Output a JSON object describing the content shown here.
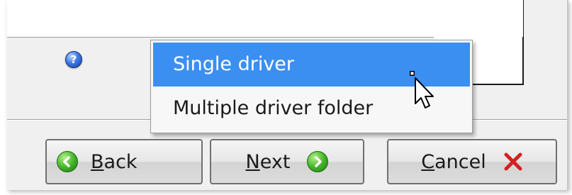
{
  "dropdown": {
    "items": [
      {
        "label": "Single driver",
        "selected": true
      },
      {
        "label": "Multiple driver folder",
        "selected": false
      }
    ]
  },
  "buttons": {
    "back": {
      "mnemonic": "B",
      "rest": "ack"
    },
    "next": {
      "mnemonic": "N",
      "rest": "ext"
    },
    "cancel": {
      "mnemonic": "C",
      "rest": "ancel"
    }
  },
  "icons": {
    "help": "help-icon",
    "back": "arrow-left-icon",
    "next": "arrow-right-icon",
    "cancel": "close-x-icon"
  },
  "colors": {
    "selection": "#3b8ff0",
    "arrow_green": "#45b52a",
    "cancel_red": "#d62020"
  }
}
